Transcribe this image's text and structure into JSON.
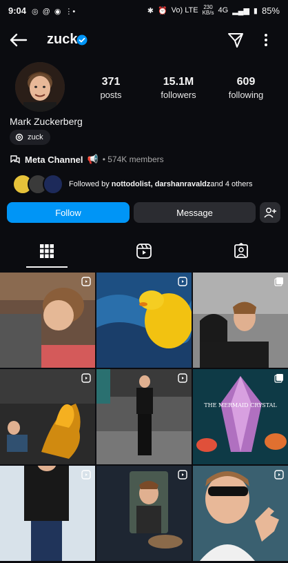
{
  "status": {
    "time": "9:04",
    "network_label": "Vo) LTE",
    "speed_value": "230",
    "speed_unit": "KB/s",
    "signal": "4G",
    "battery": "85%"
  },
  "profile": {
    "username": "zuck",
    "display_name": "Mark Zuckerberg",
    "threads_handle": "zuck",
    "stats": [
      {
        "value": "371",
        "label": "posts"
      },
      {
        "value": "15.1M",
        "label": "followers"
      },
      {
        "value": "609",
        "label": "following"
      }
    ],
    "channel": {
      "name": "Meta Channel",
      "emoji": "📢",
      "members": "• 574K members"
    },
    "followed_by": {
      "prefix": "Followed by ",
      "names": "nottodolist, darshanravaldz",
      "suffix": " and 4 others"
    }
  },
  "actions": {
    "follow": "Follow",
    "message": "Message"
  },
  "tabs": [
    {
      "name": "grid",
      "icon": "grid-icon",
      "active": true
    },
    {
      "name": "reels",
      "icon": "reels-icon",
      "active": false
    },
    {
      "name": "tagged",
      "icon": "tagged-icon",
      "active": false
    }
  ],
  "grid_posts": [
    {
      "kind": "reel",
      "art_text": ""
    },
    {
      "kind": "reel",
      "art_text": ""
    },
    {
      "kind": "carousel",
      "art_text": ""
    },
    {
      "kind": "reel",
      "art_text": ""
    },
    {
      "kind": "reel",
      "art_text": ""
    },
    {
      "kind": "carousel",
      "art_text": "THE MERMAID CRYSTAL"
    },
    {
      "kind": "reel",
      "art_text": ""
    },
    {
      "kind": "reel",
      "art_text": ""
    },
    {
      "kind": "reel",
      "art_text": ""
    }
  ],
  "colors": {
    "accent": "#0095f6",
    "background": "#0b0c10",
    "secondary_button": "#2b2c31",
    "verified": "#0095f6"
  }
}
